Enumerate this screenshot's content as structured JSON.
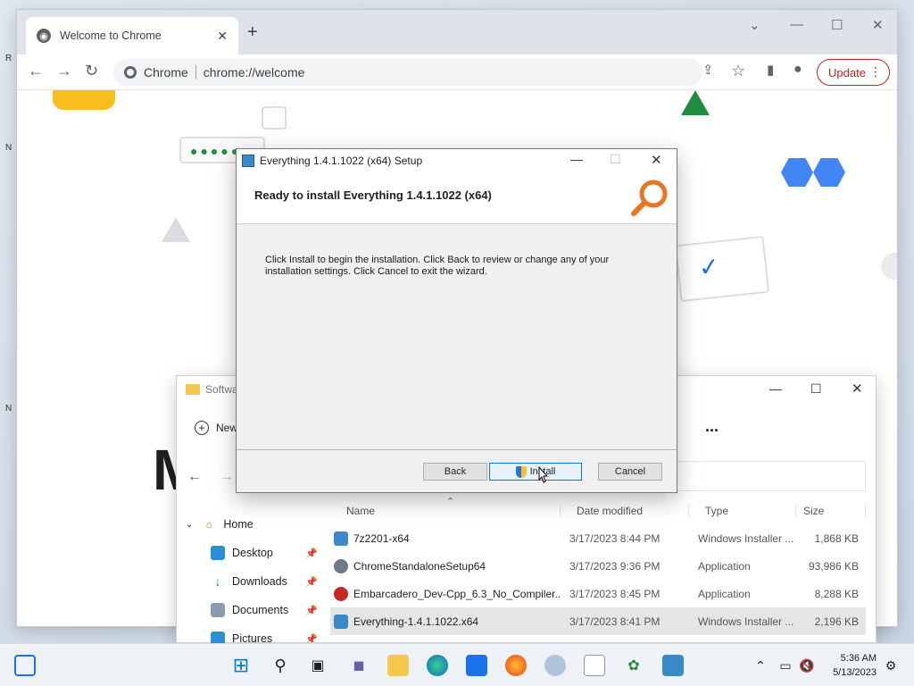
{
  "chrome": {
    "tab_title": "Welcome to Chrome",
    "tab_close": "✕",
    "new_tab": "+",
    "site_label": "Chrome",
    "url": "chrome://welcome",
    "update_label": "Update",
    "menu_dots": "⋮",
    "big_text": "M"
  },
  "setup": {
    "window_title": "Everything 1.4.1.1022 (x64) Setup",
    "heading": "Ready to install Everything 1.4.1.1022 (x64)",
    "body": "Click Install to begin the installation. Click Back to review or change any of your installation settings. Click Cancel to exit the wizard.",
    "back_label": "Back",
    "install_label": "Install",
    "cancel_label": "Cancel"
  },
  "explorer": {
    "window_title": "Softwa",
    "new_label": "New",
    "more_label": "...",
    "sidebar": [
      {
        "label": "Home",
        "icon": "home-icon",
        "expanded": true
      },
      {
        "label": "Desktop",
        "icon": "desktop-icon",
        "pinned": true
      },
      {
        "label": "Downloads",
        "icon": "download-icon",
        "pinned": true
      },
      {
        "label": "Documents",
        "icon": "document-icon",
        "pinned": true
      },
      {
        "label": "Pictures",
        "icon": "pictures-icon",
        "pinned": true
      }
    ],
    "columns": [
      "Name",
      "Date modified",
      "Type",
      "Size"
    ],
    "files": [
      {
        "name": "7z2201-x64",
        "date": "3/17/2023 8:44 PM",
        "type": "Windows Installer ...",
        "size": "1,868 KB",
        "icon_color": "#3a89c9"
      },
      {
        "name": "ChromeStandaloneSetup64",
        "date": "3/17/2023 9:36 PM",
        "type": "Application",
        "size": "93,986 KB",
        "icon_color": "#6b7b8c"
      },
      {
        "name": "Embarcadero_Dev-Cpp_6.3_No_Compiler...",
        "date": "3/17/2023 8:45 PM",
        "type": "Application",
        "size": "8,288 KB",
        "icon_color": "#c62828"
      },
      {
        "name": "Everything-1.4.1.1022.x64",
        "date": "3/17/2023 8:41 PM",
        "type": "Windows Installer ...",
        "size": "2,196 KB",
        "icon_color": "#3a89c9",
        "selected": true
      }
    ]
  },
  "taskbar": {
    "time": "5:36 AM",
    "date": "5/13/2023",
    "icons": [
      "widgets-icon",
      "start-icon",
      "search-icon",
      "task-view-icon",
      "chat-icon",
      "file-explorer-icon",
      "edge-icon",
      "store-icon",
      "firefox-icon",
      "installer-icon",
      "notepad-icon",
      "game-icon",
      "setup-icon"
    ]
  }
}
